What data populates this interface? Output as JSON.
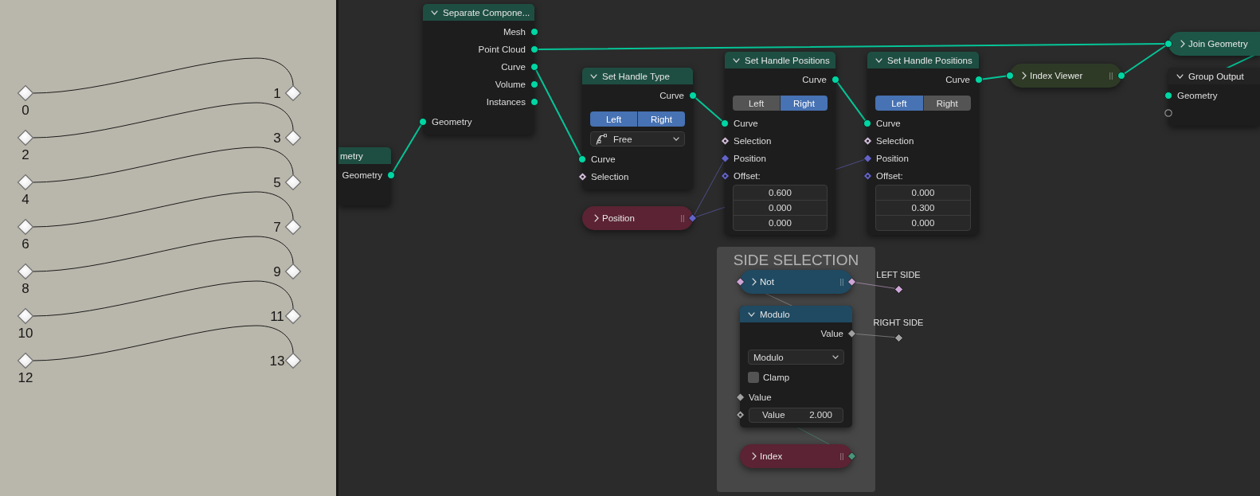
{
  "diagram": {
    "pairs": [
      {
        "start": "0",
        "end": "1"
      },
      {
        "start": "2",
        "end": "3"
      },
      {
        "start": "4",
        "end": "5"
      },
      {
        "start": "6",
        "end": "7"
      },
      {
        "start": "8",
        "end": "9"
      },
      {
        "start": "10",
        "end": "11"
      },
      {
        "start": "12",
        "end": "13"
      }
    ]
  },
  "node_editor": {
    "frames": [
      {
        "title": "SIDE SELECTION"
      }
    ],
    "nodes": [
      {
        "kind": "expanded",
        "title": "metry",
        "color": "#1e4e42",
        "rows": [
          {
            "kind": "output",
            "label": "Geometry",
            "socket": {
              "kind": "circle",
              "color": "#00d6a3"
            }
          }
        ]
      },
      {
        "kind": "expanded",
        "title": "Separate Compone...",
        "color": "#1e4e42",
        "rows": [
          {
            "kind": "output",
            "label": "Mesh",
            "socket": {
              "kind": "circle",
              "color": "#00d6a3"
            }
          },
          {
            "kind": "output",
            "label": "Point Cloud",
            "socket": {
              "kind": "circle",
              "color": "#00d6a3"
            }
          },
          {
            "kind": "output",
            "label": "Curve",
            "socket": {
              "kind": "circle",
              "color": "#00d6a3"
            }
          },
          {
            "kind": "output",
            "label": "Volume",
            "socket": {
              "kind": "circle",
              "color": "#00d6a3"
            }
          },
          {
            "kind": "output",
            "label": "Instances",
            "socket": {
              "kind": "circle",
              "color": "#00d6a3"
            }
          },
          {
            "kind": "input",
            "label": "Geometry",
            "socket": {
              "kind": "circle",
              "color": "#00d6a3"
            }
          }
        ]
      },
      {
        "kind": "expanded",
        "title": "Set Handle Type",
        "color": "#1e4e42",
        "rows": [
          {
            "kind": "output",
            "label": "Curve",
            "socket": {
              "kind": "circle",
              "color": "#00d6a3"
            }
          },
          {
            "kind": "toggle",
            "options": [
              {
                "label": "Left",
                "selected": true
              },
              {
                "label": "Right",
                "selected": true
              }
            ]
          },
          {
            "kind": "dropdown",
            "value": "Free",
            "with_icon": true
          },
          {
            "kind": "input",
            "label": "Curve",
            "socket": {
              "kind": "circle",
              "color": "#00d6a3"
            }
          },
          {
            "kind": "input",
            "label": "Selection",
            "socket": {
              "kind": "diamond_dot",
              "color": "#d4bfdb"
            }
          }
        ]
      },
      {
        "kind": "collapsed",
        "title": "Position",
        "color": "#5b2333",
        "out_socket": {
          "kind": "diamond",
          "color": "#6363c7"
        }
      },
      {
        "kind": "expanded",
        "title": "Set Handle Positions",
        "color": "#1e4e42",
        "rows": [
          {
            "kind": "output",
            "label": "Curve",
            "socket": {
              "kind": "circle",
              "color": "#00d6a3"
            }
          },
          {
            "kind": "toggle",
            "options": [
              {
                "label": "Left",
                "selected": false
              },
              {
                "label": "Right",
                "selected": true
              }
            ]
          },
          {
            "kind": "input",
            "label": "Curve",
            "socket": {
              "kind": "circle",
              "color": "#00d6a3"
            }
          },
          {
            "kind": "input",
            "label": "Selection",
            "socket": {
              "kind": "diamond_dot",
              "color": "#d4bfdb"
            }
          },
          {
            "kind": "input",
            "label": "Position",
            "socket": {
              "kind": "diamond",
              "color": "#6363c7"
            }
          },
          {
            "kind": "input",
            "label": "Offset:",
            "socket": {
              "kind": "diamond_dot",
              "color": "#6363c7"
            }
          },
          {
            "kind": "vector",
            "values": [
              "0.600",
              "0.000",
              "0.000"
            ]
          }
        ]
      },
      {
        "kind": "expanded",
        "title": "Set Handle Positions",
        "color": "#1e4e42",
        "rows": [
          {
            "kind": "output",
            "label": "Curve",
            "socket": {
              "kind": "circle",
              "color": "#00d6a3"
            }
          },
          {
            "kind": "toggle",
            "options": [
              {
                "label": "Left",
                "selected": true
              },
              {
                "label": "Right",
                "selected": false
              }
            ]
          },
          {
            "kind": "input",
            "label": "Curve",
            "socket": {
              "kind": "circle",
              "color": "#00d6a3"
            }
          },
          {
            "kind": "input",
            "label": "Selection",
            "socket": {
              "kind": "diamond_dot",
              "color": "#d4bfdb"
            }
          },
          {
            "kind": "input",
            "label": "Position",
            "socket": {
              "kind": "diamond",
              "color": "#6363c7"
            }
          },
          {
            "kind": "input",
            "label": "Offset:",
            "socket": {
              "kind": "diamond_dot",
              "color": "#6363c7"
            }
          },
          {
            "kind": "vector",
            "values": [
              "0.000",
              "0.300",
              "0.000"
            ]
          }
        ]
      },
      {
        "kind": "collapsed",
        "title": "Index Viewer",
        "color": "#2e3a26",
        "in_socket": {
          "kind": "circle",
          "color": "#00d6a3"
        },
        "out_socket": {
          "kind": "circle",
          "color": "#00d6a3"
        }
      },
      {
        "kind": "collapsed",
        "title": "Join Geometry",
        "color": "#1d5647",
        "in_socket": {
          "kind": "circle",
          "color": "#00d6a3"
        }
      },
      {
        "kind": "expanded",
        "title": "Group Output",
        "color": "#232323",
        "rows": [
          {
            "kind": "input",
            "label": "Geometry",
            "socket": {
              "kind": "circle",
              "color": "#00d6a3"
            }
          },
          {
            "kind": "input",
            "socket": {
              "kind": "ring"
            }
          }
        ]
      },
      {
        "kind": "collapsed",
        "title": "Not",
        "color": "#1f4a62",
        "in_socket": {
          "kind": "diamond",
          "color": "#cca6d6"
        },
        "out_socket": {
          "kind": "diamond",
          "color": "#cca6d6"
        }
      },
      {
        "kind": "expanded",
        "title": "Modulo",
        "color": "#1f4a62",
        "rows": [
          {
            "kind": "output",
            "label": "Value",
            "socket": {
              "kind": "diamond",
              "color": "#a1a1a1"
            }
          },
          {
            "kind": "dropdown",
            "value": "Modulo"
          },
          {
            "kind": "checkbox",
            "label": "Clamp",
            "checked": false
          },
          {
            "kind": "input",
            "label": "Value",
            "socket": {
              "kind": "diamond",
              "color": "#a1a1a1"
            }
          },
          {
            "kind": "number",
            "label": "Value",
            "value": "2.000",
            "socket": {
              "kind": "diamond_dot",
              "color": "#a1a1a1"
            }
          }
        ]
      },
      {
        "kind": "collapsed",
        "title": "Index",
        "color": "#5b2333",
        "out_socket": {
          "kind": "diamond",
          "color": "#4a9479"
        }
      }
    ],
    "reroutes": [
      {
        "label": "LEFT SIDE",
        "socket": {
          "kind": "diamond",
          "color": "#cca6d6"
        }
      },
      {
        "label": "RIGHT SIDE",
        "socket": {
          "kind": "diamond",
          "color": "#a1a1a1"
        }
      }
    ]
  }
}
